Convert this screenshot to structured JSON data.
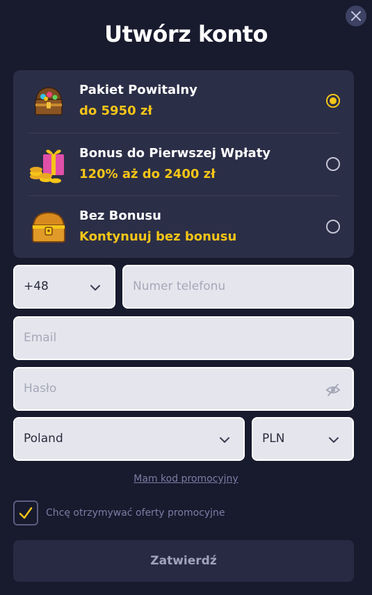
{
  "title": "Utwórz konto",
  "bonuses": [
    {
      "title": "Pakiet Powitalny",
      "subtitle": "do 5950 zł",
      "selected": true
    },
    {
      "title": "Bonus do Pierwszej Wpłaty",
      "subtitle": "120% aż do 2400 zł",
      "selected": false
    },
    {
      "title": "Bez Bonusu",
      "subtitle": "Kontynuuj bez bonusu",
      "selected": false
    }
  ],
  "phone": {
    "country_code": "+48",
    "placeholder": "Numer telefonu"
  },
  "email": {
    "placeholder": "Email"
  },
  "password": {
    "placeholder": "Hasło"
  },
  "country": {
    "value": "Poland"
  },
  "currency": {
    "value": "PLN"
  },
  "promo_link": "Mam kod promocyjny",
  "consent": {
    "label": "Chcę otrzymywać oferty promocyjne",
    "checked": true
  },
  "submit_label": "Zatwierdź",
  "colors": {
    "background": "#181a2e",
    "panel": "#2b2e47",
    "accent": "#f5c518",
    "field": "#e5e5ed"
  }
}
